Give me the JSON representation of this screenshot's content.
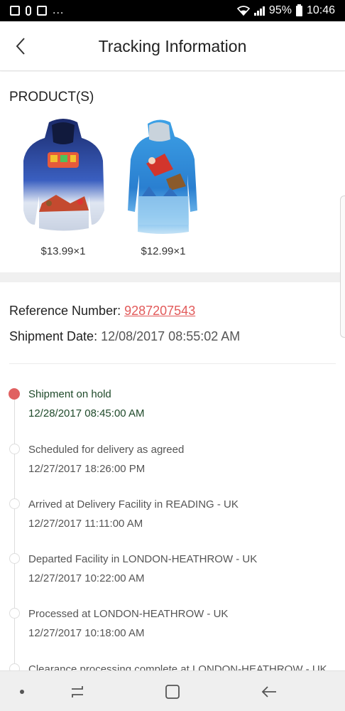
{
  "status_bar": {
    "dots": "...",
    "battery_percent": "95%",
    "time": "10:46"
  },
  "header": {
    "title": "Tracking Information",
    "back_icon": "chevron-left-icon"
  },
  "products": {
    "heading": "PRODUCT(S)",
    "items": [
      {
        "image": "navy-christmas-hoodie",
        "price": "$13.99×1"
      },
      {
        "image": "blue-christmas-hoodie-dress",
        "price": "$12.99×1"
      }
    ]
  },
  "reference": {
    "number_label": "Reference Number:",
    "number_value": "9287207543",
    "date_label": "Shipment Date:",
    "date_value": "12/08/2017 08:55:02 AM"
  },
  "timeline": [
    {
      "status": "Shipment on hold",
      "time": "12/28/2017 08:45:00 AM",
      "active": true
    },
    {
      "status": "Scheduled for delivery as agreed",
      "time": "12/27/2017 18:26:00 PM",
      "active": false
    },
    {
      "status": "Arrived at Delivery Facility in  READING - UK",
      "time": "12/27/2017 11:11:00 AM",
      "active": false
    },
    {
      "status": "Departed Facility in  LONDON-HEATHROW - UK",
      "time": "12/27/2017 10:22:00 AM",
      "active": false
    },
    {
      "status": "Processed at  LONDON-HEATHROW - UK",
      "time": "12/27/2017 10:18:00 AM",
      "active": false
    },
    {
      "status": "Clearance processing complete at  LONDON-HEATHROW - UK",
      "time": "",
      "active": false
    }
  ],
  "colors": {
    "accent": "#e06161",
    "active_text": "#1f4a2a",
    "link": "#e25a5a"
  },
  "nav_bar": {
    "icons": [
      "dot-icon",
      "recent-apps-icon",
      "home-icon",
      "back-arrow-icon"
    ]
  }
}
